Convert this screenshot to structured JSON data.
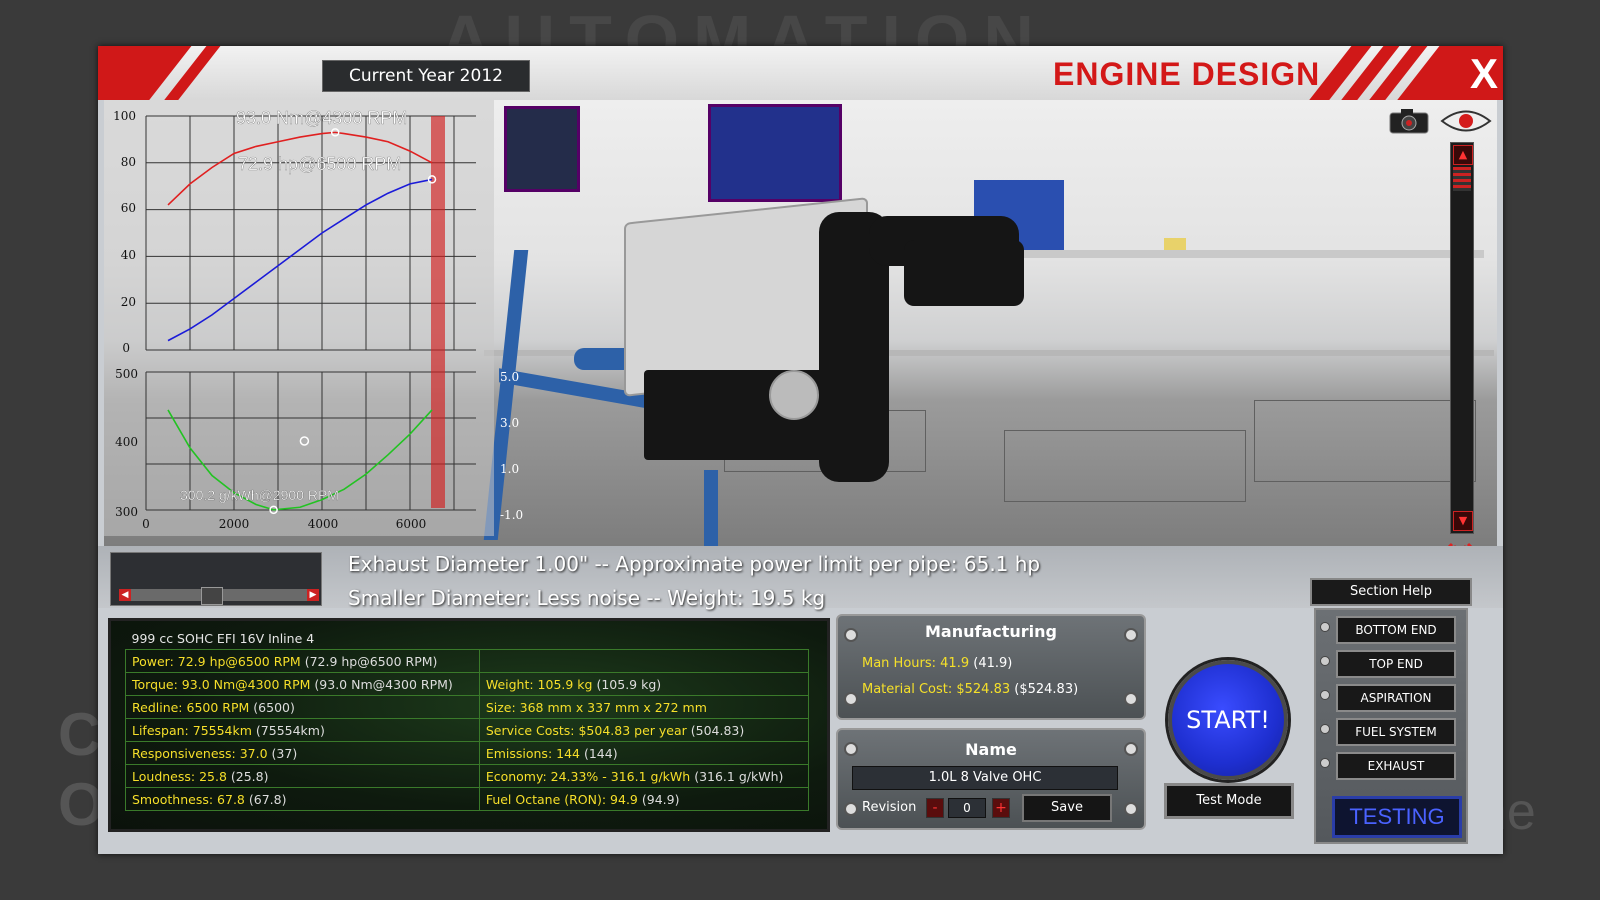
{
  "background": {
    "logo_text": "AUTOMATION",
    "left_fragment_1": "C",
    "left_fragment_2": "O",
    "right_fragment": "ne"
  },
  "titlebar": {
    "current_year": "Current Year 2012",
    "title": "ENGINE DESIGN",
    "close_label": "X",
    "accent_color": "#d01818"
  },
  "graph": {
    "upper_yticks": [
      "100",
      "80",
      "60",
      "40",
      "20",
      "0"
    ],
    "lower_yticks": [
      "500",
      "400",
      "300"
    ],
    "xticks": [
      "0",
      "2000",
      "4000",
      "6000"
    ],
    "right_ticks": [
      "5.0",
      "3.0",
      "1.0",
      "-1.0"
    ],
    "torque_label": "93.0 Nm@4300 RPM",
    "power_label": "72.9 hp@6500 RPM",
    "bsfc_label": "300.2 g/kWh@2900 RPM"
  },
  "chart_data": [
    {
      "type": "line",
      "title": "",
      "xlabel": "",
      "ylabel": "",
      "xlim": [
        0,
        7500
      ],
      "ylim": [
        0,
        100
      ],
      "series": [
        {
          "name": "",
          "color": "#e02020",
          "x": [
            500,
            1000,
            1500,
            2000,
            2500,
            3000,
            3500,
            4000,
            4300,
            4500,
            5000,
            5500,
            6000,
            6500
          ],
          "values": [
            62,
            71,
            78,
            84,
            87,
            89,
            91,
            92.5,
            93.0,
            92.5,
            91,
            89,
            85,
            80
          ]
        },
        {
          "name": "",
          "color": "#1b1bd8",
          "x": [
            500,
            1000,
            1500,
            2000,
            2500,
            3000,
            3500,
            4000,
            4500,
            5000,
            5500,
            6000,
            6500
          ],
          "values": [
            4,
            9,
            15,
            22,
            29,
            36,
            43,
            50,
            56,
            62,
            67,
            71,
            72.9
          ]
        }
      ],
      "annotations": [
        "93.0 Nm@4300 RPM",
        "72.9 hp@6500 RPM"
      ]
    },
    {
      "type": "line",
      "title": "",
      "xlabel": "",
      "ylabel": "",
      "xlim": [
        0,
        7500
      ],
      "ylim": [
        300,
        500
      ],
      "series": [
        {
          "name": "",
          "color": "#22c322",
          "x": [
            500,
            1000,
            1500,
            2000,
            2500,
            2900,
            3500,
            4000,
            4500,
            5000,
            5500,
            6000,
            6500
          ],
          "values": [
            445,
            390,
            350,
            325,
            308,
            300.2,
            304,
            315,
            330,
            352,
            380,
            410,
            445
          ]
        }
      ],
      "marker": {
        "x": 3600,
        "y": 400
      },
      "annotations": [
        "300.2 g/kWh@2900 RPM"
      ]
    }
  ],
  "description": {
    "line1": "Exhaust Diameter 1.00\" -- Approximate power limit per pipe: 65.1 hp",
    "line2": "Smaller Diameter: Less noise -- Weight: 19.5 kg",
    "section_help": "Section Help"
  },
  "stats": {
    "header": "999 cc SOHC EFI 16V Inline 4",
    "rows": [
      {
        "left": "Power: 72.9 hp@6500 RPM",
        "left_paren": "(72.9 hp@6500 RPM)",
        "right": "",
        "right_paren": ""
      },
      {
        "left": "Torque: 93.0 Nm@4300 RPM",
        "left_paren": "(93.0 Nm@4300 RPM)",
        "right": "Weight: 105.9 kg",
        "right_paren": "(105.9 kg)"
      },
      {
        "left": "Redline: 6500 RPM",
        "left_paren": "(6500)",
        "right": "Size: 368 mm x 337 mm x 272 mm",
        "right_paren": ""
      },
      {
        "left": "Lifespan: 75554km",
        "left_paren": "(75554km)",
        "right": "Service Costs: $504.83 per year",
        "right_paren": "(504.83)"
      },
      {
        "left": "Responsiveness: 37.0",
        "left_paren": "(37)",
        "right": "Emissions: 144",
        "right_paren": "(144)"
      },
      {
        "left": "Loudness: 25.8",
        "left_paren": "(25.8)",
        "right": "Economy: 24.33% - 316.1 g/kWh",
        "right_paren": "(316.1 g/kWh)"
      },
      {
        "left": "Smoothness: 67.8",
        "left_paren": "(67.8)",
        "right": "Fuel Octane (RON): 94.9",
        "right_paren": "(94.9)"
      }
    ]
  },
  "manufacturing": {
    "title": "Manufacturing",
    "man_hours_label": "Man Hours: 41.9",
    "man_hours_paren": "(41.9)",
    "material_cost_label": "Material Cost: $524.83",
    "material_cost_paren": "($524.83)"
  },
  "name_panel": {
    "title": "Name",
    "engine_name": "1.0L 8 Valve OHC",
    "revision_label": "Revision",
    "revision_value": "0",
    "minus": "-",
    "plus": "+",
    "save_label": "Save"
  },
  "actions": {
    "start_label": "START!",
    "test_mode_label": "Test Mode"
  },
  "nav": {
    "items": [
      "BOTTOM END",
      "TOP END",
      "ASPIRATION",
      "FUEL SYSTEM",
      "EXHAUST"
    ],
    "testing_label": "TESTING"
  }
}
